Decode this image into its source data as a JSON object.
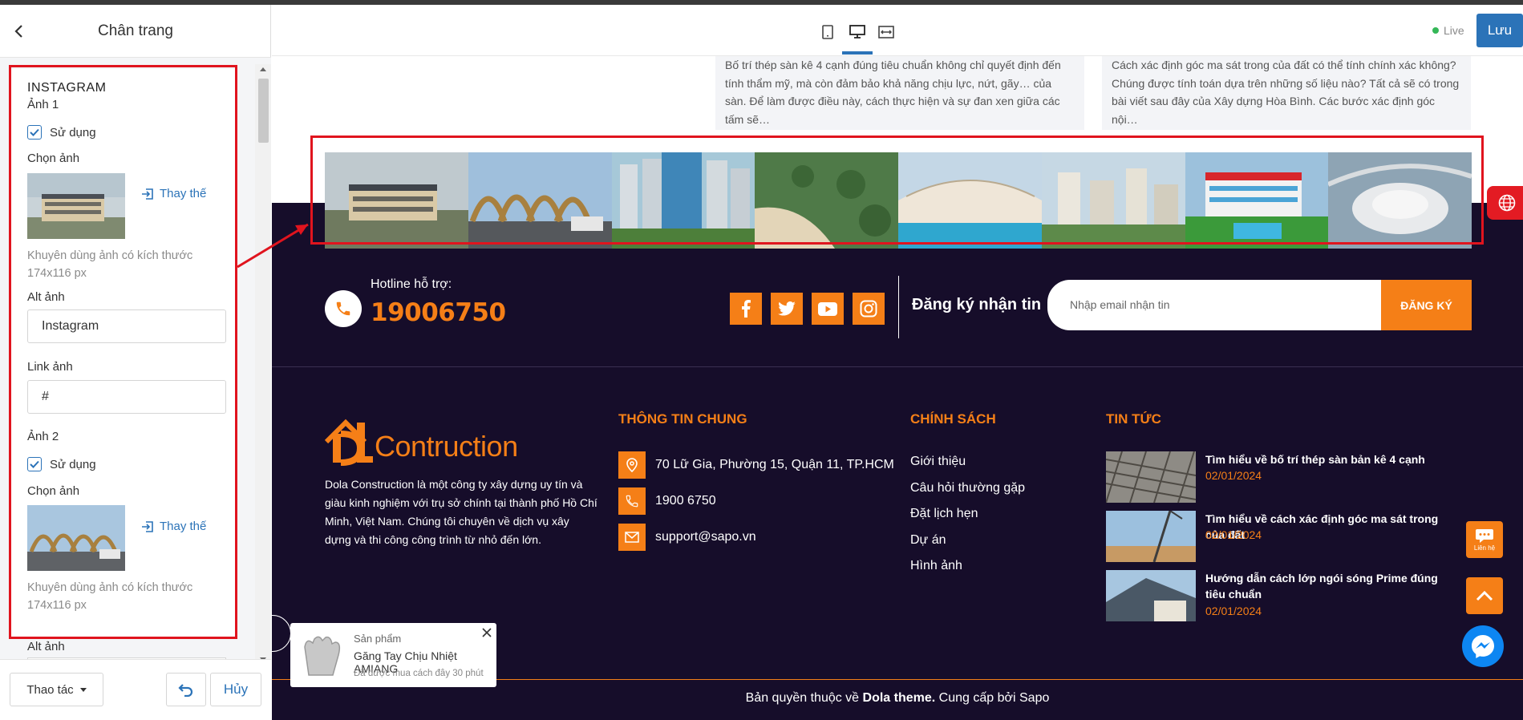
{
  "panel": {
    "title": "Chân trang",
    "section_title": "INSTAGRAM",
    "image1": {
      "heading": "Ảnh 1",
      "use_label": "Sử dụng",
      "choose_label": "Chọn ảnh",
      "replace_label": "Thay thế",
      "hint": "Khuyên dùng ảnh có kích thước 174x116 px",
      "alt_label": "Alt ảnh",
      "alt_value": "Instagram",
      "link_label": "Link ảnh",
      "link_value": "#"
    },
    "image2": {
      "heading": "Ảnh 2",
      "use_label": "Sử dụng",
      "choose_label": "Chọn ảnh",
      "replace_label": "Thay thế",
      "hint": "Khuyên dùng ảnh có kích thước 174x116 px",
      "alt_label": "Alt ảnh"
    },
    "actions_label": "Thao tác",
    "cancel_label": "Hủy"
  },
  "toolbar": {
    "live_label": "Live",
    "save_label": "Lưu",
    "devices": [
      "mobile-icon",
      "desktop-icon",
      "fullwidth-icon"
    ]
  },
  "preview": {
    "cards": [
      "Bố trí thép sàn kê 4 cạnh đúng tiêu chuẩn không chỉ quyết định đến tính thẩm mỹ, mà còn đảm bảo khả năng chịu lực, nứt, gãy… của sàn. Để làm được điều này, cách thực hiện và sự đan xen giữa các tấm sẽ…",
      "Cách xác định góc ma sát trong của đất có thể tính chính xác không? Chúng được tính toán dựa trên những số liệu nào? Tất cả sẽ có trong bài viết sau đây của Xây dựng Hòa Bình. Các bước xác định góc nội…"
    ],
    "hotline_label": "Hotline hỗ trợ:",
    "hotline_number": "19006750",
    "social_icons": [
      "facebook-icon",
      "twitter-icon",
      "youtube-icon",
      "instagram-icon"
    ],
    "newsletter_title": "Đăng ký nhận tin",
    "newsletter_placeholder": "Nhập email nhận tin",
    "newsletter_button": "ĐĂNG KÝ",
    "logo_text": "Contruction",
    "about": "Dola Construction là một công ty xây dựng uy tín và giàu kinh nghiệm với trụ sở chính tại thành phố Hồ Chí Minh, Việt Nam. Chúng tôi chuyên về dịch vụ xây dựng và thi công công trình từ nhỏ đến lớn.",
    "info_heading": "THÔNG TIN CHUNG",
    "address": "70 Lữ Gia, Phường 15, Quận 11, TP.HCM",
    "phone": "1900 6750",
    "email": "support@sapo.vn",
    "policy_heading": "CHÍNH SÁCH",
    "policies": [
      "Giới thiệu",
      "Câu hỏi thường gặp",
      "Đặt lịch hẹn",
      "Dự án",
      "Hình ảnh"
    ],
    "news_heading": "TIN TỨC",
    "news": [
      {
        "title": "Tìm hiểu về bố trí thép sàn bản kê 4 cạnh",
        "date": "02/01/2024"
      },
      {
        "title": "Tìm hiểu về cách xác định góc ma sát trong của đất",
        "date": "02/01/2024"
      },
      {
        "title": "Hướng dẫn cách lớp ngói sóng Prime đúng tiêu chuẩn",
        "date": "02/01/2024"
      }
    ],
    "copyright_prefix": "Bản quyền thuộc về ",
    "copyright_brand": "Dola theme.",
    "copyright_suffix": " Cung cấp bởi Sapo",
    "popup": {
      "category": "Sản phẩm",
      "name": "Găng Tay Chịu Nhiệt AMIANG",
      "time": "Đã được mua cách đây 30 phút"
    },
    "contact_fab_label": "Liên hệ"
  },
  "colors": {
    "accent": "#f57f17",
    "dark_bg": "#160d2a",
    "primary": "#2b73b8",
    "annotation": "#e0141e"
  }
}
